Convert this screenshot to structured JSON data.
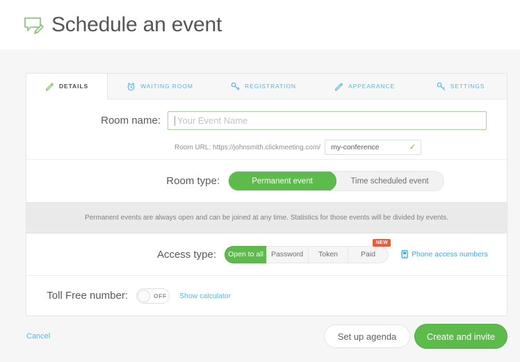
{
  "header": {
    "title": "Schedule an event",
    "icon": "speech-bubble-pencil-icon"
  },
  "tabs": [
    {
      "label": "DETAILS",
      "icon": "pencil-icon",
      "active": true
    },
    {
      "label": "WAITING ROOM",
      "icon": "alarm-clock-icon",
      "active": false
    },
    {
      "label": "REGISTRATION",
      "icon": "key-icon",
      "active": false
    },
    {
      "label": "APPEARANCE",
      "icon": "pencil-icon",
      "active": false
    },
    {
      "label": "SETTINGS",
      "icon": "wrench-icon",
      "active": false
    }
  ],
  "room_name": {
    "label": "Room name:",
    "placeholder": "Your Event Name",
    "value": "",
    "url_label": "Room URL: https://johnsmith.clickmeeting.com/",
    "slug_value": "my-conference",
    "valid_icon": "check-icon"
  },
  "room_type": {
    "label": "Room type:",
    "options": [
      "Permanent event",
      "Time scheduled event"
    ],
    "selected": "Permanent event",
    "info": "Permanent events are always open and can be joined at any time. Statistics for those events will be divided by events."
  },
  "access_type": {
    "label": "Access type:",
    "options": [
      "Open to all",
      "Password",
      "Token",
      "Paid"
    ],
    "selected": "Open to all",
    "badge": "NEW",
    "phone_link": "Phone access numbers",
    "phone_icon": "phone-icon"
  },
  "toll_free": {
    "label": "Toll Free number:",
    "toggle_state": "OFF",
    "calculator_link": "Show calculator"
  },
  "footer": {
    "cancel": "Cancel",
    "agenda": "Set up agenda",
    "create": "Create and invite"
  },
  "colors": {
    "green": "#5cbb4b",
    "blue": "#5bb7e0",
    "red": "#ef5a3c",
    "text": "#585858"
  }
}
